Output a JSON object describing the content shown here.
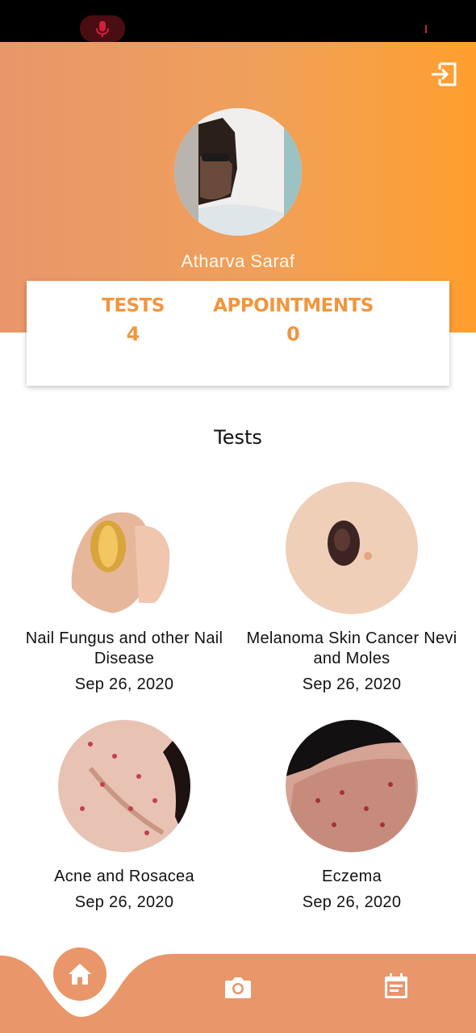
{
  "status_bar": {
    "mic_icon": "microphone-icon"
  },
  "header": {
    "user_name": "Atharva Saraf",
    "logout_icon": "logout-icon"
  },
  "stats": {
    "tests_label": "TESTS",
    "tests_value": "4",
    "appointments_label": "APPOINTMENTS",
    "appointments_value": "0"
  },
  "section": {
    "title": "Tests"
  },
  "tests": [
    {
      "name": "Nail Fungus and other Nail Disease",
      "date": "Sep 26, 2020"
    },
    {
      "name": "Melanoma Skin Cancer Nevi and Moles",
      "date": "Sep 26, 2020"
    },
    {
      "name": "Acne and Rosacea",
      "date": "Sep 26, 2020"
    },
    {
      "name": "Eczema",
      "date": "Sep 26, 2020"
    }
  ],
  "bottom_nav": {
    "items": [
      {
        "icon": "home-icon"
      },
      {
        "icon": "camera-icon"
      },
      {
        "icon": "calendar-icon"
      }
    ]
  },
  "colors": {
    "accent": "#f0963e",
    "nav_background": "#e9966a",
    "header_gradient_start": "#e9966a",
    "header_gradient_end": "#ff9f2e"
  }
}
